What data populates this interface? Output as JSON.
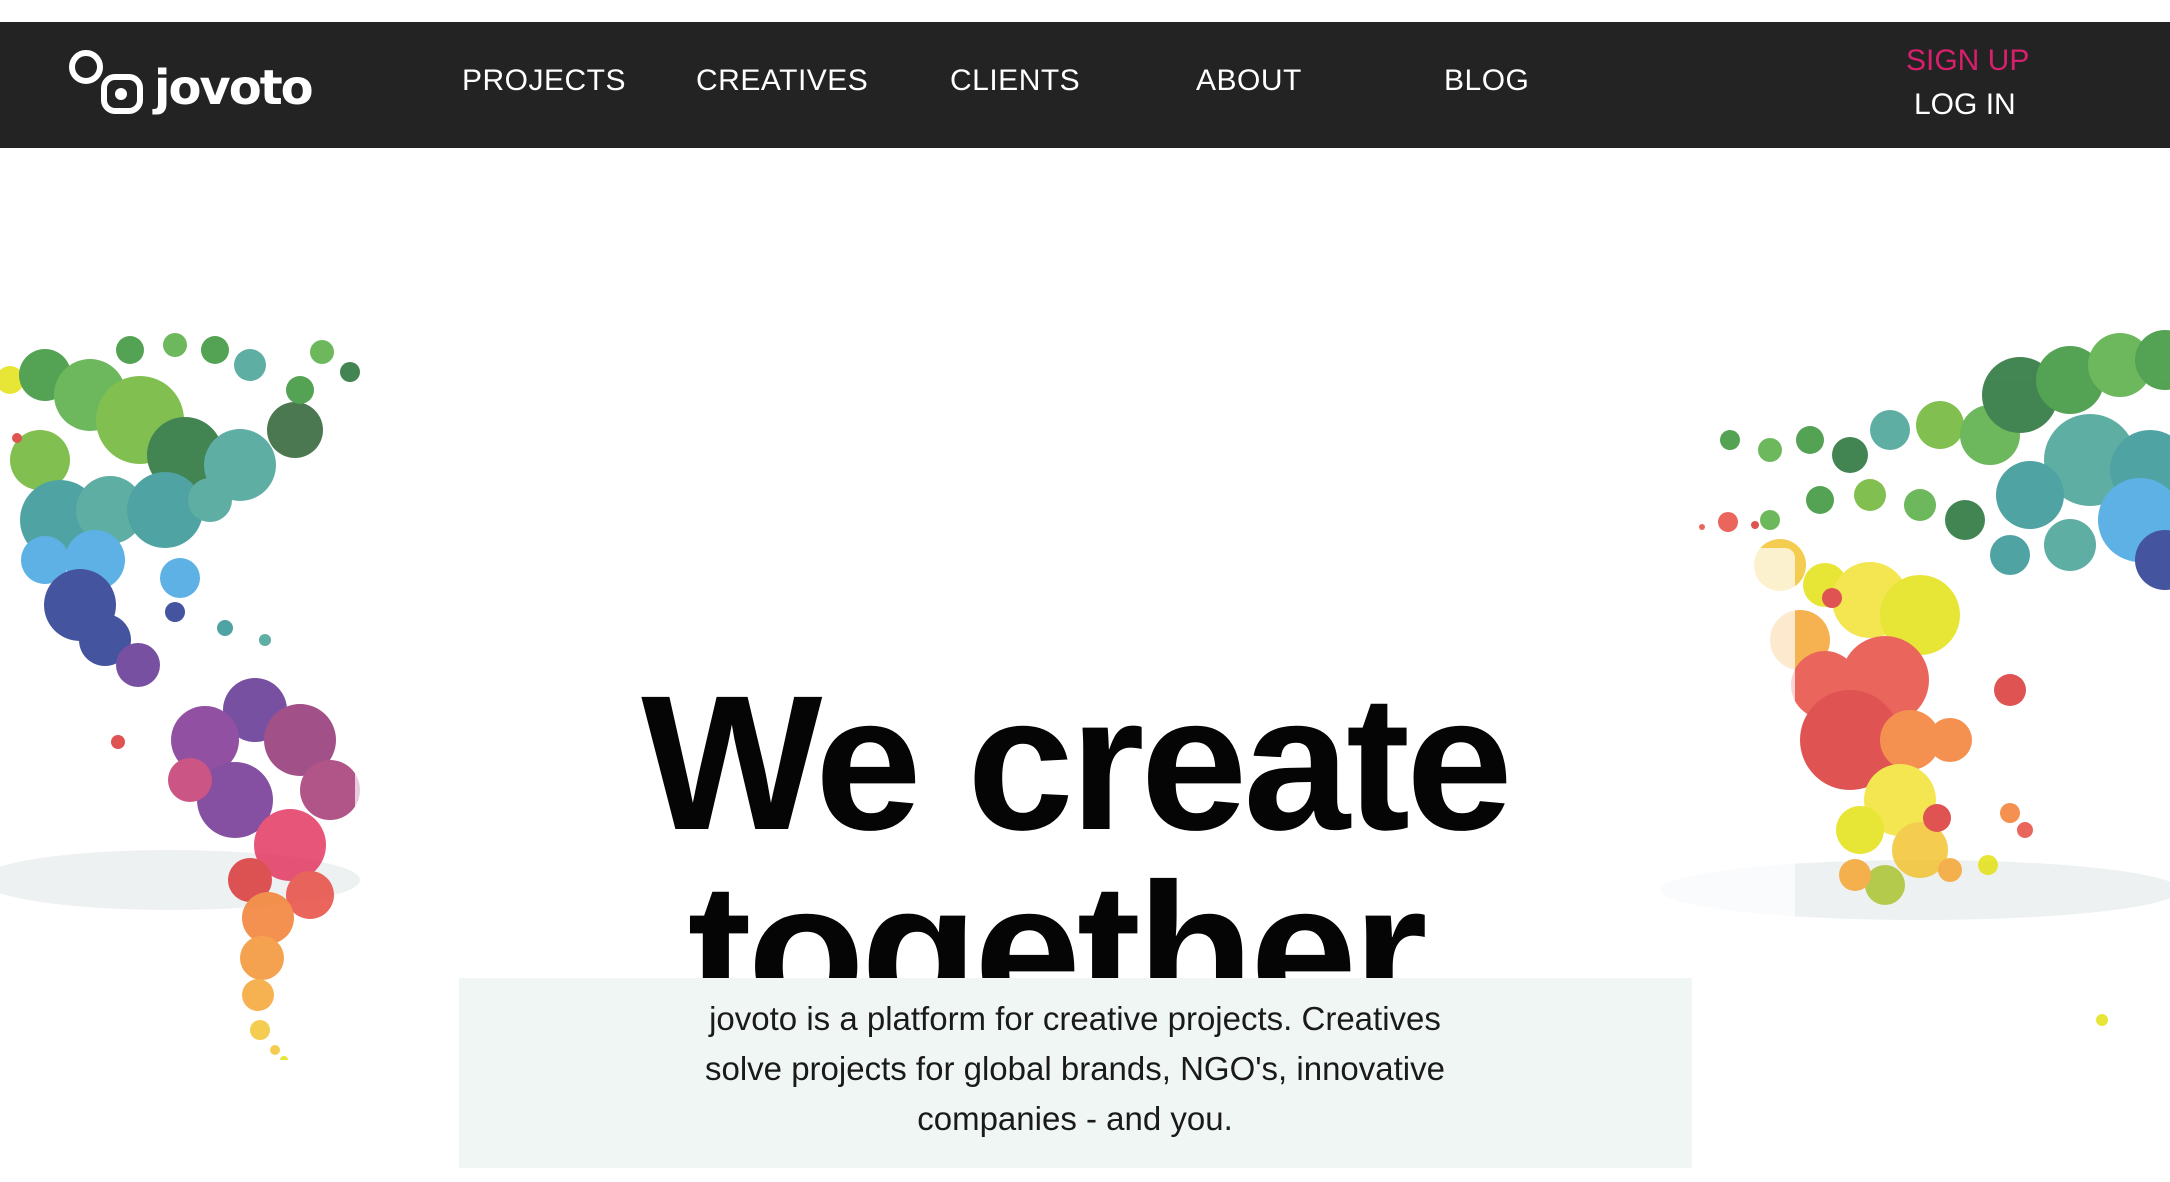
{
  "brand": {
    "name": "jovoto"
  },
  "nav": {
    "items": [
      "PROJECTS",
      "CREATIVES",
      "CLIENTS",
      "ABOUT",
      "BLOG"
    ],
    "signup_label": "SIGN UP",
    "login_label": "LOG IN"
  },
  "hero": {
    "headline_line1": "We create",
    "headline_line2": "together.",
    "intro": "jovoto is a platform for creative projects. Creatives solve projects for global brands, NGO's, innovative companies - and you."
  },
  "colors": {
    "nav_bg": "#232323",
    "signup": "#d6206b",
    "intro_bg": "#f0f6f3"
  }
}
